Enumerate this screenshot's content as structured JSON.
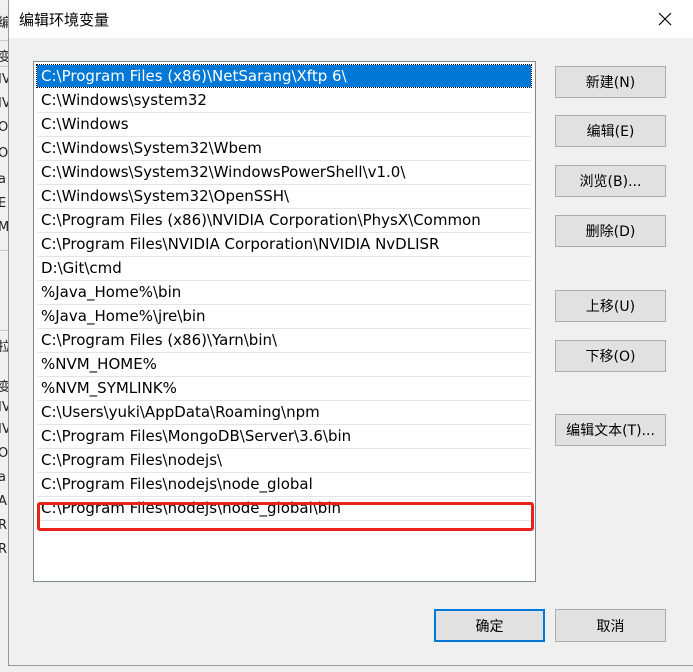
{
  "dialog": {
    "title": "编辑环境变量"
  },
  "background": {
    "chars": [
      "编",
      "变",
      "IV",
      "IV",
      "Or",
      "Or",
      "a",
      "E",
      "M",
      "拉",
      "变",
      "IV",
      "IV",
      "OS",
      "a",
      "A",
      "R",
      "R"
    ]
  },
  "path_list": {
    "items": [
      "C:\\Program Files (x86)\\NetSarang\\Xftp 6\\",
      "C:\\Windows\\system32",
      "C:\\Windows",
      "C:\\Windows\\System32\\Wbem",
      "C:\\Windows\\System32\\WindowsPowerShell\\v1.0\\",
      "C:\\Windows\\System32\\OpenSSH\\",
      "C:\\Program Files (x86)\\NVIDIA Corporation\\PhysX\\Common",
      "C:\\Program Files\\NVIDIA Corporation\\NVIDIA NvDLISR",
      "D:\\Git\\cmd",
      "%Java_Home%\\bin",
      "%Java_Home%\\jre\\bin",
      "C:\\Program Files (x86)\\Yarn\\bin\\",
      "%NVM_HOME%",
      "%NVM_SYMLINK%",
      "C:\\Users\\yuki\\AppData\\Roaming\\npm",
      "C:\\Program Files\\MongoDB\\Server\\3.6\\bin",
      "C:\\Program Files\\nodejs\\",
      "C:\\Program Files\\nodejs\\node_global",
      "C:\\Program Files\\nodejs\\node_global\\bin"
    ],
    "selected_index": 0
  },
  "buttons": {
    "new": "新建(N)",
    "edit": "编辑(E)",
    "browse": "浏览(B)...",
    "delete": "删除(D)",
    "move_up": "上移(U)",
    "move_down": "下移(O)",
    "edit_text": "编辑文本(T)...",
    "ok": "确定",
    "cancel": "取消"
  },
  "colors": {
    "selection": "#0078d7",
    "highlight_box": "#e8211a"
  }
}
